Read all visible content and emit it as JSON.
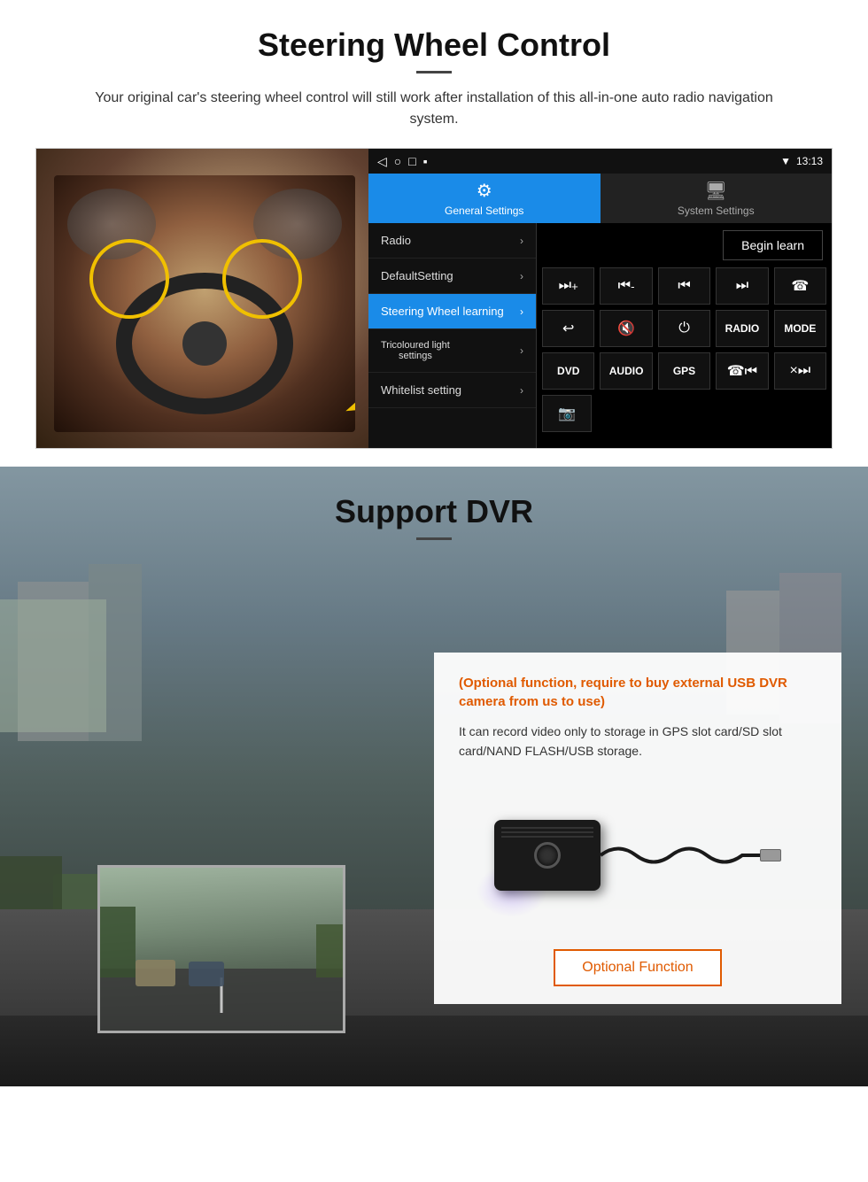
{
  "steering": {
    "title": "Steering Wheel Control",
    "description": "Your original car's steering wheel control will still work after installation of this all-in-one auto radio navigation system.",
    "statusbar": {
      "icons": [
        "◁",
        "○",
        "□",
        "▪"
      ],
      "time": "13:13",
      "signals": "▼"
    },
    "tabs": {
      "general": "General Settings",
      "system": "System Settings"
    },
    "menu_items": [
      {
        "label": "Radio",
        "active": false
      },
      {
        "label": "DefaultSetting",
        "active": false
      },
      {
        "label": "Steering Wheel learning",
        "active": true
      },
      {
        "label": "Tricoloured light\nsettings",
        "active": false
      },
      {
        "label": "Whitelist setting",
        "active": false
      }
    ],
    "begin_learn": "Begin learn",
    "control_buttons": {
      "row1": [
        "⏭+",
        "⏮-",
        "⏮⏮",
        "⏭⏭",
        "☎"
      ],
      "row2": [
        "↩",
        "🔇×",
        "⏻",
        "RADIO",
        "MODE"
      ],
      "row3": [
        "DVD",
        "AUDIO",
        "GPS",
        "☎⏮",
        "×⏭"
      ],
      "row4": [
        "📷"
      ]
    }
  },
  "dvr": {
    "title": "Support DVR",
    "optional_text": "(Optional function, require to buy external USB DVR camera from us to use)",
    "description": "It can record video only to storage in GPS slot card/SD slot card/NAND FLASH/USB storage.",
    "button_label": "Optional Function"
  }
}
